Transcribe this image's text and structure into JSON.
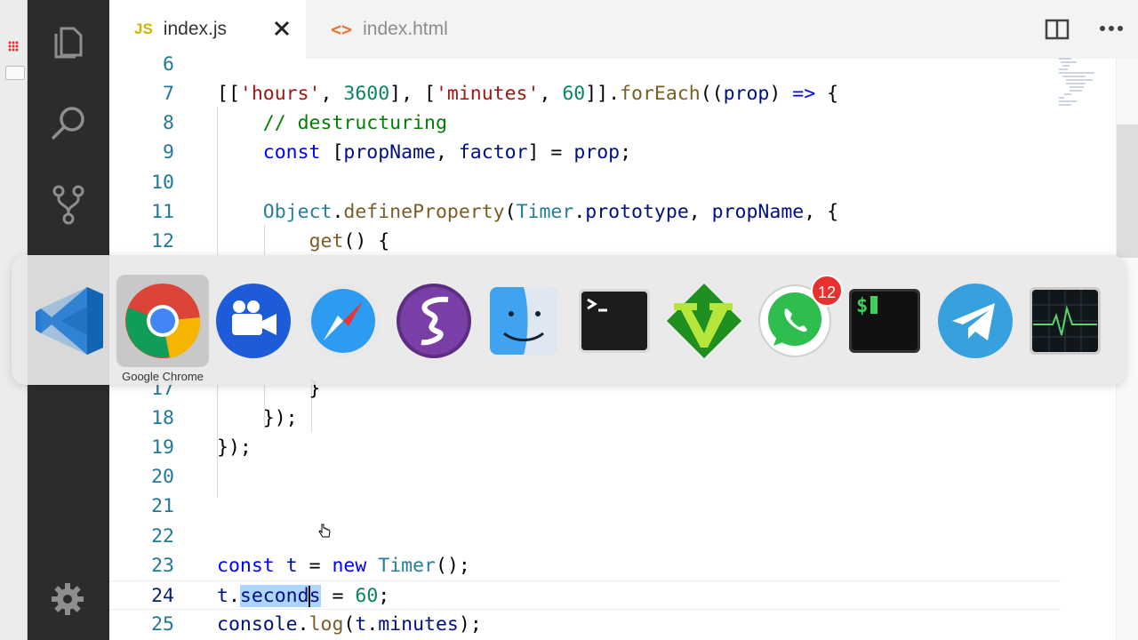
{
  "editor": {
    "tabs": [
      {
        "badge": "JS",
        "label": "index.js",
        "active": true
      },
      {
        "badge": "<>",
        "label": "index.html",
        "active": false
      }
    ],
    "line_numbers": [
      "6",
      "7",
      "8",
      "9",
      "10",
      "11",
      "12",
      "17",
      "18",
      "19",
      "20",
      "21",
      "22",
      "23",
      "24",
      "25"
    ],
    "current_line": "24",
    "selected_text": "seconds"
  },
  "dock": {
    "apps": [
      {
        "name": "vscode-icon"
      },
      {
        "name": "chrome-icon",
        "label": "Google Chrome",
        "selected": true
      },
      {
        "name": "screen-recorder-icon"
      },
      {
        "name": "safari-icon"
      },
      {
        "name": "emacs-icon"
      },
      {
        "name": "finder-icon"
      },
      {
        "name": "terminal-icon"
      },
      {
        "name": "vim-icon"
      },
      {
        "name": "whatsapp-icon",
        "badge": "12"
      },
      {
        "name": "iterm-icon"
      },
      {
        "name": "telegram-icon"
      },
      {
        "name": "activity-monitor-icon"
      }
    ],
    "hover_label": "Google Chrome",
    "whatsapp_badge": "12"
  },
  "colors": {
    "keyword": "#0000ff",
    "string": "#a31515",
    "number": "#098658",
    "function": "#795e26",
    "variable": "#001080",
    "type": "#267f99",
    "comment": "#008000",
    "line_number": "#237893",
    "activity_bar": "#2c2c2c"
  }
}
